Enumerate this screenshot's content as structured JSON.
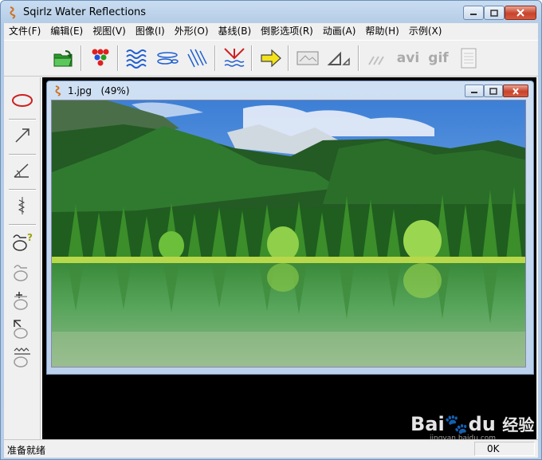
{
  "window": {
    "title": "Sqirlz Water Reflections"
  },
  "menu": [
    "文件(F)",
    "编辑(E)",
    "视图(V)",
    "图像(I)",
    "外形(O)",
    "基线(B)",
    "倒影选项(R)",
    "动画(A)",
    "帮助(H)",
    "示例(X)"
  ],
  "toolbar": {
    "avi_label": "avi",
    "gif_label": "gif"
  },
  "document": {
    "title": "1.jpg",
    "zoom": "(49%)"
  },
  "status": {
    "left": "准备就绪",
    "right": "0K"
  },
  "watermark": {
    "brand_a": "Bai",
    "brand_b": "du",
    "brand_cn": "经验",
    "url": "jingyan.baidu.com"
  },
  "colors": {
    "accent": "#d02020",
    "title_gradient": "#b8cde6"
  }
}
